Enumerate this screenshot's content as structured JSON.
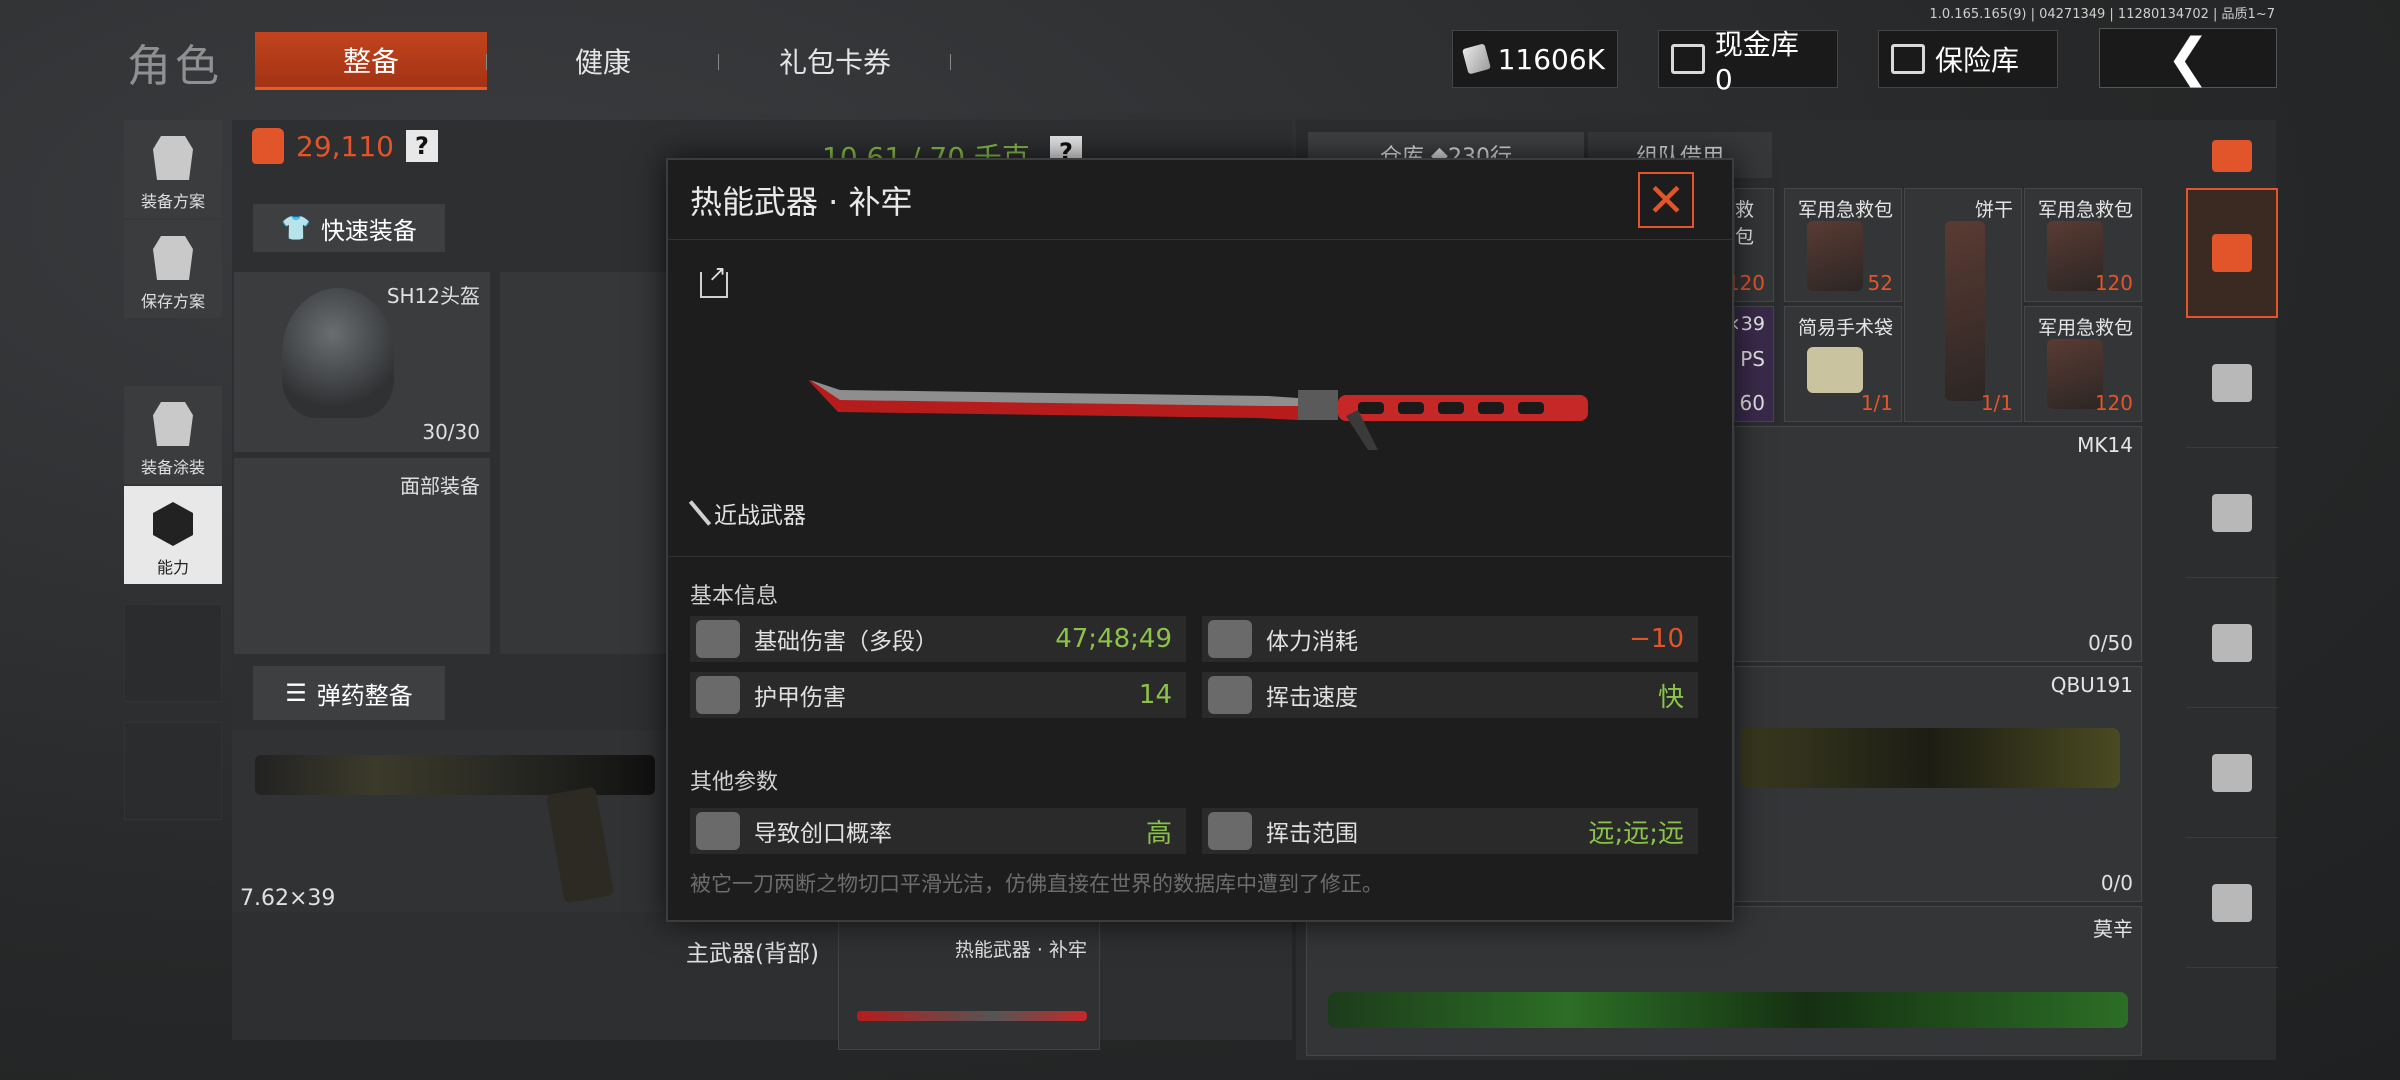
{
  "version": "1.0.165.165(9) | 04271349 | 11280134702 | 品质1~7",
  "header": {
    "title": "角色",
    "tabs": [
      {
        "label": "整备",
        "active": true
      },
      {
        "label": "健康",
        "active": false
      },
      {
        "label": "礼包卡券",
        "active": false
      }
    ],
    "money": "11606K",
    "cash_vault": "现金库 0",
    "insurance_vault": "保险库",
    "back_icon": "chevron-left-icon"
  },
  "left_rail": [
    {
      "label": "装备方案",
      "icon": "vest-icon"
    },
    {
      "label": "保存方案",
      "icon": "download-icon"
    },
    {
      "label": "装备涂装",
      "icon": "helmet-paint-icon"
    },
    {
      "label": "能力",
      "icon": "hexagon-bolt-icon",
      "active": true
    }
  ],
  "loadout": {
    "weight": "29,110",
    "capacity": "10.61 / 70 千克",
    "quick_equip": "快速装备",
    "helmet_name": "SH12头盔",
    "helmet_durability": "30/30",
    "face_gear": "面部装备",
    "ammo_button": "弹药整备",
    "caliber": "7.62×39",
    "main_weapon_back_label": "主武器(背部)",
    "main_weapon_name": "热能武器 · 补牢"
  },
  "storage": {
    "tab_store": "仓库",
    "tab_store_count": "230行",
    "tab_team": "组队借用",
    "items": [
      {
        "name": "救包",
        "count": "120"
      },
      {
        "name": "军用急救包",
        "count": "52"
      },
      {
        "name": "饼干",
        "count": ""
      },
      {
        "name": "军用急救包",
        "count": "120"
      },
      {
        "name": "×39",
        "sub": "PS",
        "count": "60"
      },
      {
        "name": "简易手术袋",
        "count": "1/1"
      },
      {
        "name": "",
        "count": "1/1"
      },
      {
        "name": "军用急救包",
        "count": "120"
      }
    ],
    "weapons": [
      {
        "name": "MK14",
        "count": "0/50"
      },
      {
        "name": "QBU191",
        "count": "0/0"
      },
      {
        "name": "莫辛",
        "count": ""
      }
    ]
  },
  "modal": {
    "title": "热能武器 · 补牢",
    "category": "近战武器",
    "basic_info_title": "基本信息",
    "basic_stats": [
      {
        "label": "基础伤害（多段）",
        "value": "47;48;49",
        "color": "green",
        "icon": "broken-heart-icon"
      },
      {
        "label": "体力消耗",
        "value": "−10",
        "color": "red",
        "icon": "stamina-icon"
      },
      {
        "label": "护甲伤害",
        "value": "14",
        "color": "green",
        "icon": "armor-damage-icon"
      },
      {
        "label": "挥击速度",
        "value": "快",
        "color": "green",
        "icon": "swing-speed-icon"
      }
    ],
    "other_params_title": "其他参数",
    "other_stats": [
      {
        "label": "导致创口概率",
        "value": "高",
        "color": "green",
        "icon": "wound-icon"
      },
      {
        "label": "挥击范围",
        "value": "远;远;远",
        "color": "green",
        "icon": "axe-range-icon"
      }
    ],
    "flavor_text": "被它一刀两断之物切口平滑光洁，仿佛直接在世界的数据库中遭到了修正。"
  },
  "colors": {
    "accent": "#e2552a",
    "positive": "#8bc34a",
    "panel": "#1d1d1d"
  }
}
